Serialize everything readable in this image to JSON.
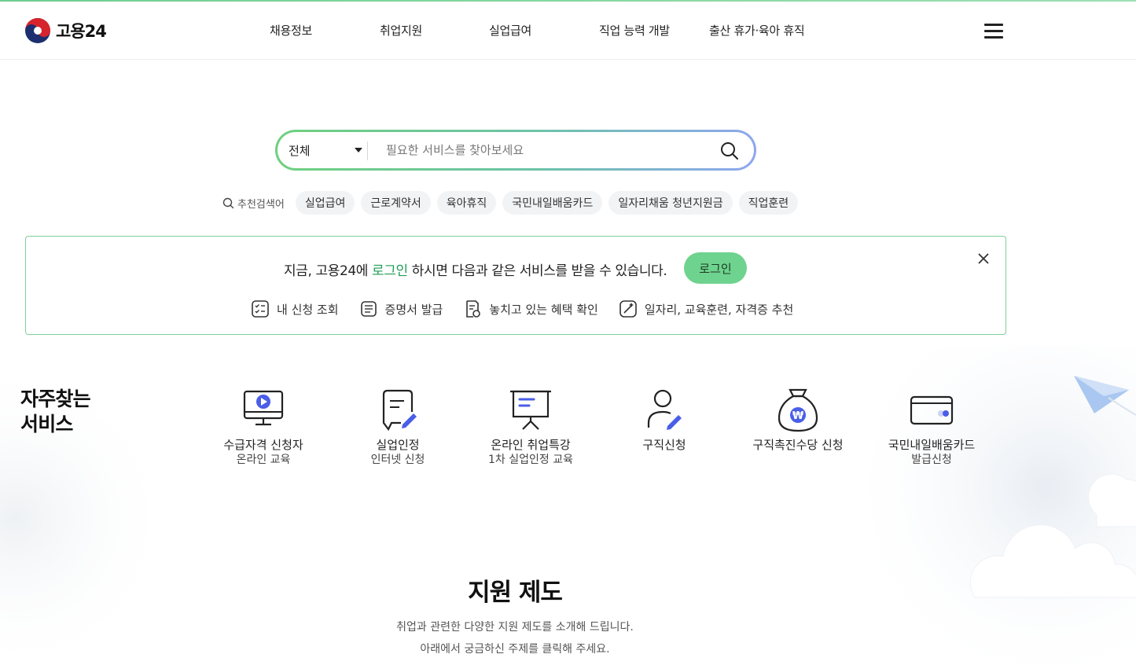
{
  "header": {
    "logo_text": "고용24",
    "nav": [
      "채용정보",
      "취업지원",
      "실업급여",
      "직업 능력 개발",
      "출산 휴가·육아 휴직"
    ]
  },
  "search": {
    "scope": "전체",
    "placeholder": "필요한 서비스를 찾아보세요",
    "value": ""
  },
  "recommended": {
    "label": "추천검색어",
    "keywords": [
      "실업급여",
      "근로계약서",
      "육아휴직",
      "국민내일배움카드",
      "일자리채움 청년지원금",
      "직업훈련"
    ]
  },
  "login_banner": {
    "msg_before": "지금, 고용24에 ",
    "msg_highlight": "로그인",
    "msg_after": " 하시면 다음과 같은 서비스를 받을 수 있습니다.",
    "login_button": "로그인",
    "services": [
      {
        "label": "내 신청 조회",
        "icon": "checklist-icon"
      },
      {
        "label": "증명서 발급",
        "icon": "certificate-icon"
      },
      {
        "label": "놓치고 있는 혜택 확인",
        "icon": "benefit-check-icon"
      },
      {
        "label": "일자리, 교육훈련, 자격증 추천",
        "icon": "recommend-icon"
      }
    ]
  },
  "frequent": {
    "title_line1": "자주찾는",
    "title_line2": "서비스",
    "items": [
      {
        "line1": "수급자격 신청자",
        "line2": "온라인 교육",
        "icon": "video-monitor-icon"
      },
      {
        "line1": "실업인정",
        "line2": "인터넷 신청",
        "icon": "document-edit-icon"
      },
      {
        "line1": "온라인 취업특강",
        "line2": "1차 실업인정 교육",
        "icon": "presentation-board-icon"
      },
      {
        "line1": "구직신청",
        "line2": "",
        "icon": "person-edit-icon"
      },
      {
        "line1": "구직촉진수당 신청",
        "line2": "",
        "icon": "money-bag-icon"
      },
      {
        "line1": "국민내일배움카드",
        "line2": "발급신청",
        "icon": "card-icon"
      }
    ]
  },
  "support": {
    "title": "지원 제도",
    "desc_line1": "취업과 관련한 다양한 지원 제도를 소개해 드립니다.",
    "desc_line2": "아래에서 궁금하신 주제를 클릭해 주세요."
  },
  "colors": {
    "accent_green": "#6ed38e",
    "highlight_green": "#1f9d55",
    "icon_blue": "#4a5ee8",
    "banner_border": "#7fd09a"
  }
}
